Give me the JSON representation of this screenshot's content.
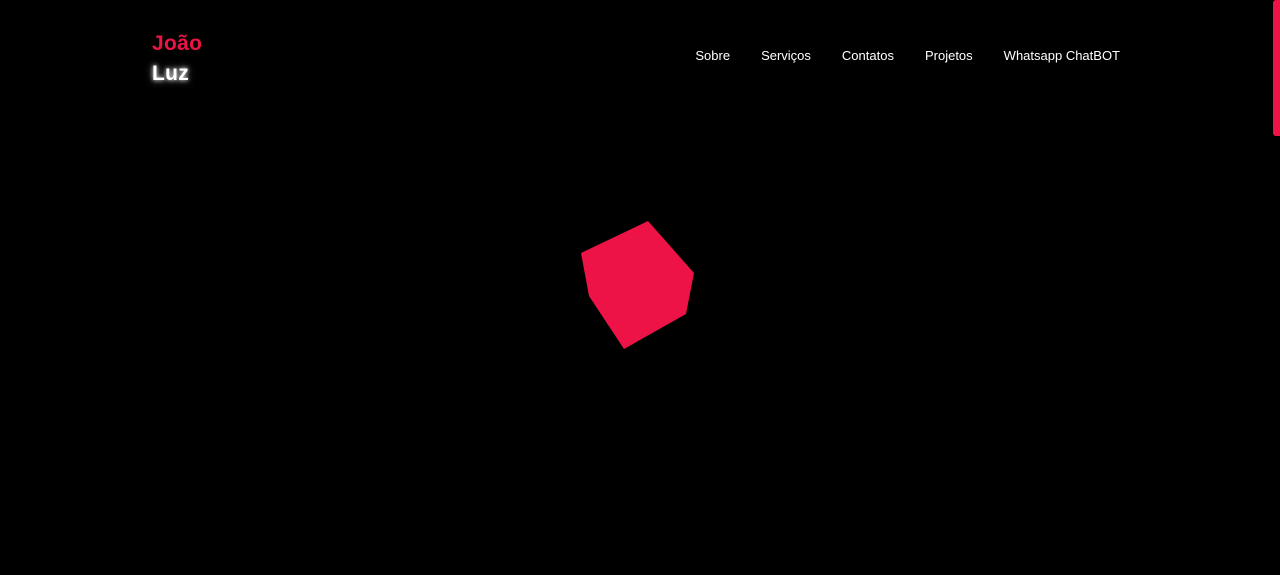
{
  "brand": {
    "first_name": "João",
    "last_name": "Luz"
  },
  "nav": {
    "items": [
      {
        "label": "Sobre"
      },
      {
        "label": "Serviços"
      },
      {
        "label": "Contatos"
      },
      {
        "label": "Projetos"
      },
      {
        "label": "Whatsapp ChatBOT"
      }
    ]
  },
  "theme": {
    "background": "#000000",
    "accent": "#ee1346",
    "text": "#ffffff"
  },
  "hero": {
    "shape": "rotating-cube",
    "shape_color": "#ee1346"
  }
}
